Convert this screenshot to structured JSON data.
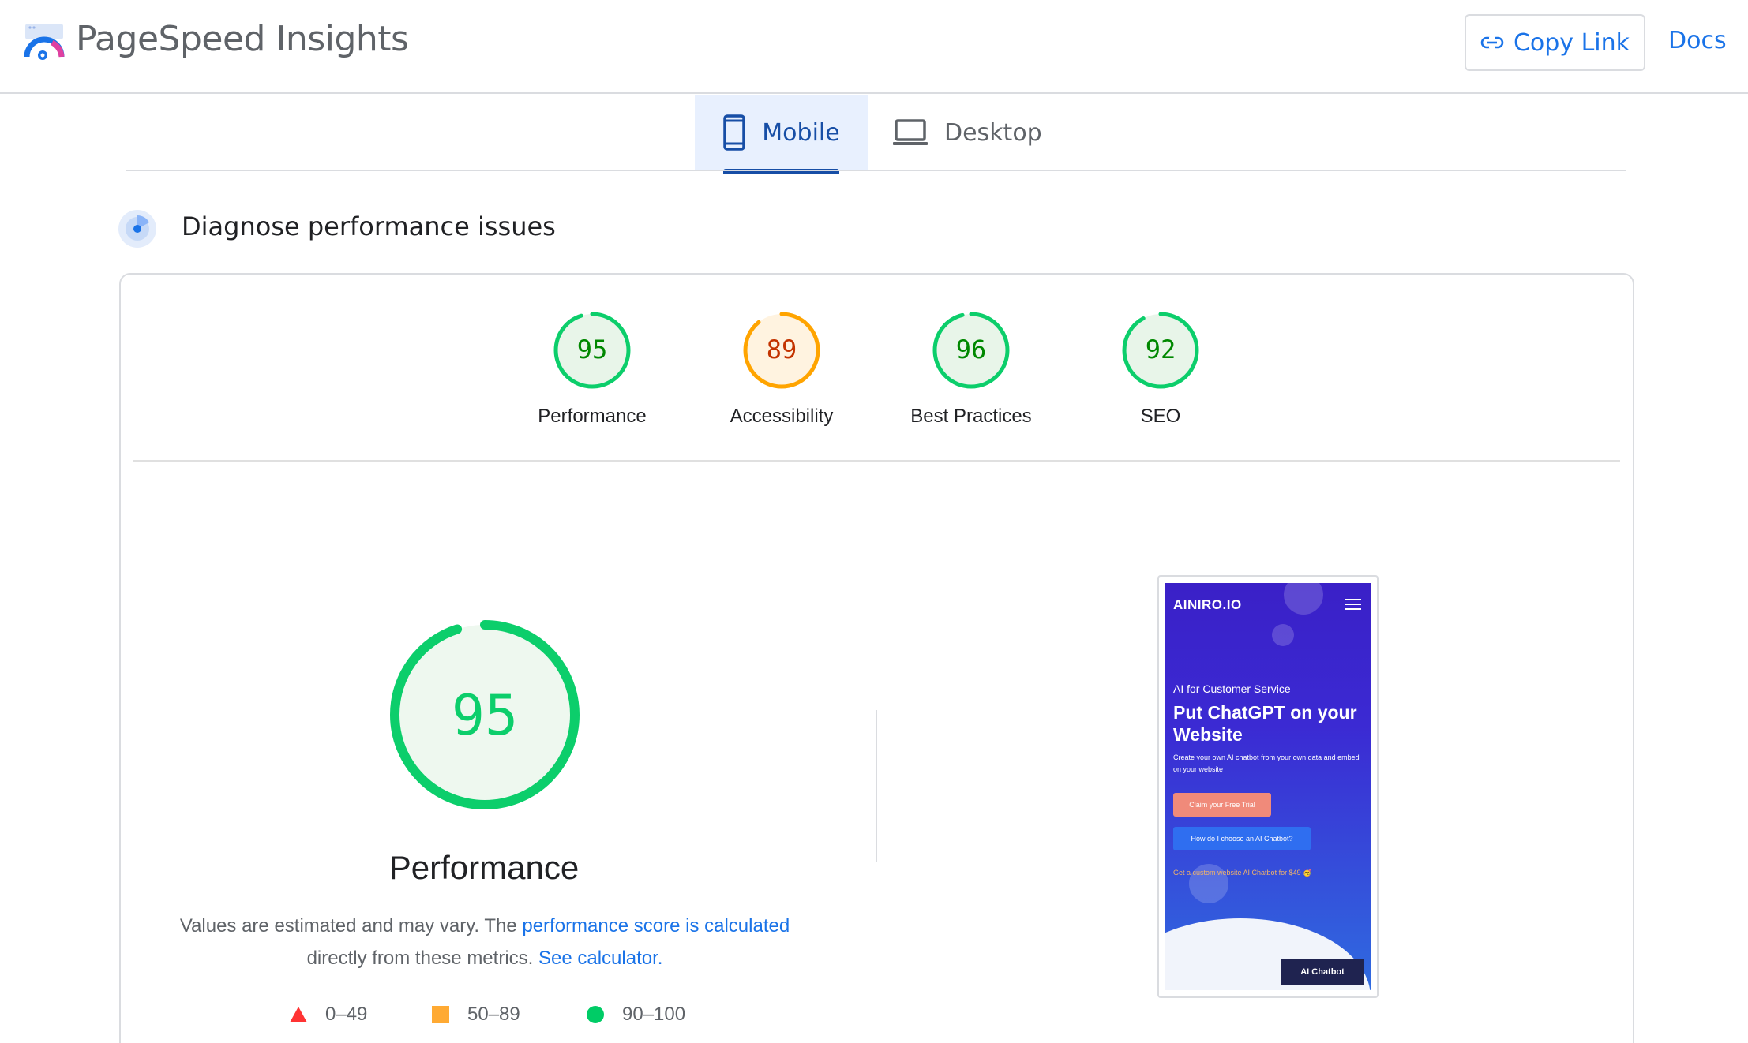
{
  "header": {
    "app_title": "PageSpeed Insights",
    "copy_link_label": "Copy Link",
    "docs_label": "Docs"
  },
  "tabs": [
    {
      "label": "Mobile",
      "icon": "smartphone-icon",
      "selected": true
    },
    {
      "label": "Desktop",
      "icon": "laptop-icon",
      "selected": false
    }
  ],
  "diagnose": {
    "title": "Diagnose performance issues",
    "icon": "radar-icon"
  },
  "scores": [
    {
      "label": "Performance",
      "value": "95",
      "status": "pass"
    },
    {
      "label": "Accessibility",
      "value": "89",
      "status": "average"
    },
    {
      "label": "Best Practices",
      "value": "96",
      "status": "pass"
    },
    {
      "label": "SEO",
      "value": "92",
      "status": "pass"
    }
  ],
  "performance": {
    "score": "95",
    "title": "Performance",
    "desc_prefix": "Values are estimated and may vary. The ",
    "desc_link1": "performance score is calculated",
    "desc_mid": " directly from these metrics. ",
    "desc_link2": "See calculator."
  },
  "legend": [
    {
      "range": "0–49",
      "shape": "triangle",
      "color": "#f33"
    },
    {
      "range": "50–89",
      "shape": "square",
      "color": "#fa3"
    },
    {
      "range": "90–100",
      "shape": "circle",
      "color": "#0c6"
    }
  ],
  "colors": {
    "pass": "#0cce6b",
    "pass_text": "#008800",
    "pass_bg": "#e8f5e9",
    "average": "#ffa400",
    "average_text": "#c33300",
    "average_bg": "#fff3e0",
    "accent": "#1a73e8"
  },
  "page_screenshot": {
    "brand": "AINIRO.IO",
    "eyebrow": "AI for Customer Service",
    "headline": "Put ChatGPT on your Website",
    "subtext": "Create your own AI chatbot from your own data and embed on your website",
    "cta_primary": "Claim your Free Trial",
    "cta_secondary": "How do I choose an AI Chatbot?",
    "promo": "Get a custom website AI Chatbot for $49 🥳",
    "chatbot_button": "AI Chatbot"
  }
}
